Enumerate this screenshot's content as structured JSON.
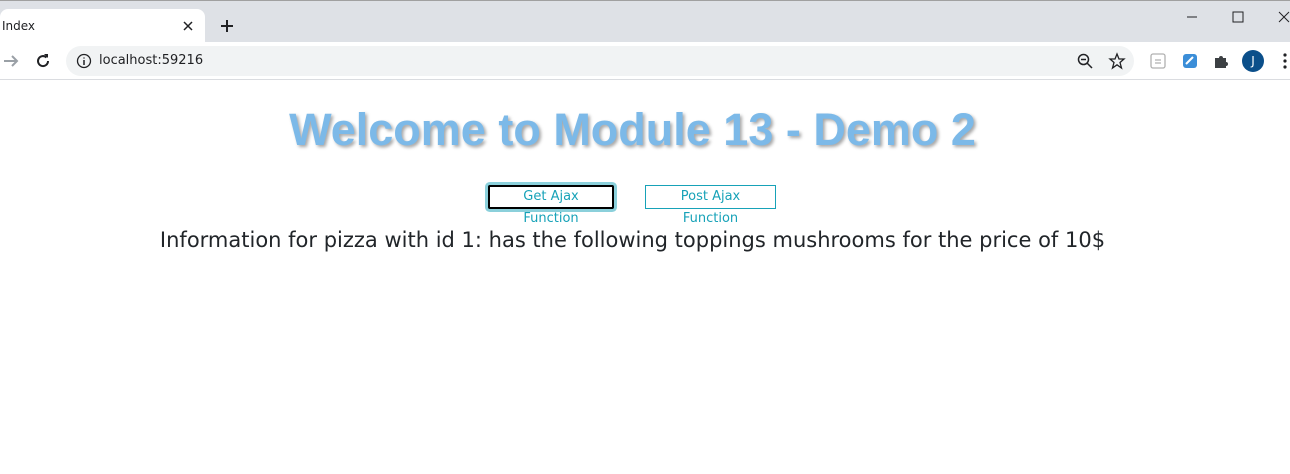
{
  "browser": {
    "tab_title": "Index",
    "url": "localhost:59216",
    "profile_initial": "J"
  },
  "page": {
    "heading": "Welcome to Module 13 - Demo 2",
    "buttons": {
      "get": "Get Ajax Function",
      "post": "Post Ajax Function"
    },
    "result_text": "Information for pizza with id 1: has the following toppings mushrooms for the price of 10$"
  },
  "colors": {
    "heading": "#7cb9e8",
    "button_accent": "#17a2b8",
    "tabstrip": "#dee1e6"
  }
}
